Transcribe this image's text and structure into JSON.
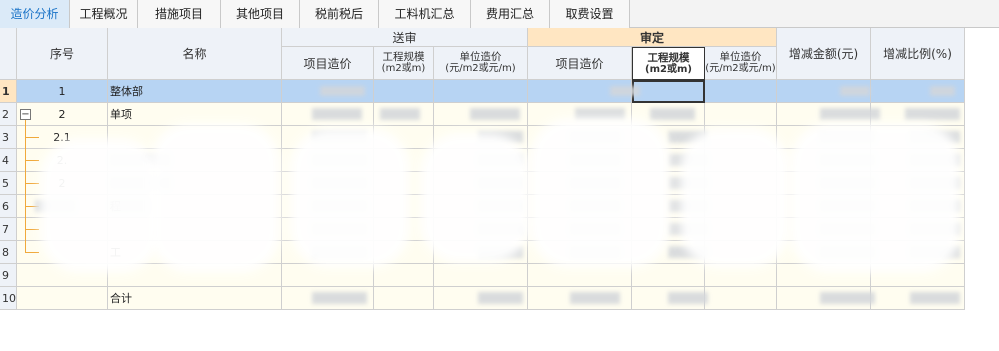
{
  "tabs": [
    {
      "label": "造价分析",
      "active": true
    },
    {
      "label": "工程概况"
    },
    {
      "label": "措施项目"
    },
    {
      "label": "其他项目"
    },
    {
      "label": "税前税后"
    },
    {
      "label": "工料机汇总"
    },
    {
      "label": "费用汇总"
    },
    {
      "label": "取费设置"
    }
  ],
  "header": {
    "seq": "序号",
    "name": "名称",
    "submitted_group": "送审",
    "approved_group": "审定",
    "cost": "项目造价",
    "scale": "工程规模",
    "scale_unit": "(m2或m)",
    "unit_cost": "单位造价",
    "unit_cost_unit": "(元/m2或元/m)",
    "approved_cost": "项目造价",
    "approved_scale": "工程规模",
    "approved_scale_unit": "(m2或m)",
    "approved_unit_cost": "单位造价",
    "approved_unit_cost_unit": "(元/m2或元/m)",
    "change_amount": "增减金额(元)",
    "change_ratio": "增减比例(%)"
  },
  "rows": [
    {
      "num": "1",
      "seq": "1",
      "name": "整体部"
    },
    {
      "num": "2",
      "seq": "2",
      "name": "单项"
    },
    {
      "num": "3",
      "seq": "2.1",
      "name": ""
    },
    {
      "num": "4",
      "seq": "2.",
      "name": ""
    },
    {
      "num": "5",
      "seq": "2",
      "name": ""
    },
    {
      "num": "6",
      "seq": "",
      "name": "程"
    },
    {
      "num": "7",
      "seq": "",
      "name": ""
    },
    {
      "num": "8",
      "seq": "",
      "name": "工"
    },
    {
      "num": "9",
      "seq": "",
      "name": ""
    },
    {
      "num": "10",
      "seq": "",
      "name": "合计"
    }
  ],
  "colors": {
    "tab_active": "#1a73c7",
    "header_bg": "#eef2f8",
    "approved_bg": "#ffe6c2",
    "selected_row": "#b7d4f3",
    "cell_bg": "#fffdf0",
    "tree_line": "#f0a93c"
  },
  "icons": {
    "collapse": "minus-box-icon"
  },
  "collapse_symbol": "−"
}
